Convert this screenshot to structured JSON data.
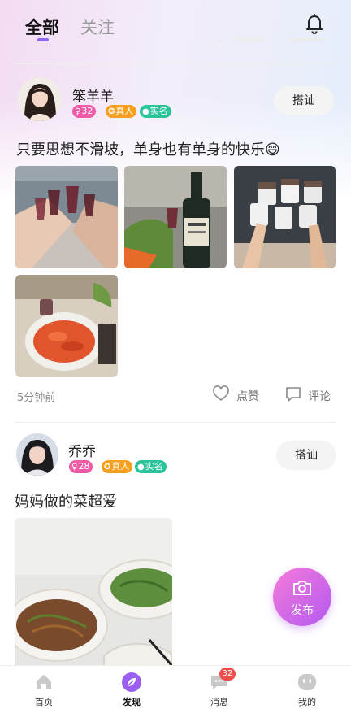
{
  "header": {
    "tabs": [
      {
        "label": "全部",
        "active": true
      },
      {
        "label": "关注",
        "active": false
      }
    ],
    "notification_icon": "bell-icon"
  },
  "posts": [
    {
      "username": "笨羊羊",
      "age": "32",
      "badge_real_person": "真人",
      "badge_real_name": "实名",
      "chat_label": "搭讪",
      "text": "只要思想不滑坡，单身也有单身的快乐😄",
      "photo_count": 4,
      "time": "5分钟前",
      "like_label": "点赞",
      "comment_label": "评论"
    },
    {
      "username": "乔乔",
      "age": "28",
      "badge_real_person": "真人",
      "badge_real_name": "实名",
      "chat_label": "搭讪",
      "text": "妈妈做的菜超爱",
      "photo_count": 1
    }
  ],
  "fab": {
    "label": "发布",
    "icon": "camera-icon"
  },
  "bottom_nav": [
    {
      "label": "首页",
      "icon": "home-icon",
      "active": false
    },
    {
      "label": "发现",
      "icon": "discover-leaf-icon",
      "active": true
    },
    {
      "label": "消息",
      "icon": "message-icon",
      "active": false,
      "badge": "32"
    },
    {
      "label": "我的",
      "icon": "profile-icon",
      "active": false
    }
  ],
  "colors": {
    "accent": "#8a68f0",
    "fab_start": "#f57ad8",
    "fab_end": "#b45af2",
    "badge_age": "#f05aa6",
    "badge_real_person": "#f5a021",
    "badge_real_name": "#2bc49a",
    "msg_badge": "#f24d4d"
  }
}
